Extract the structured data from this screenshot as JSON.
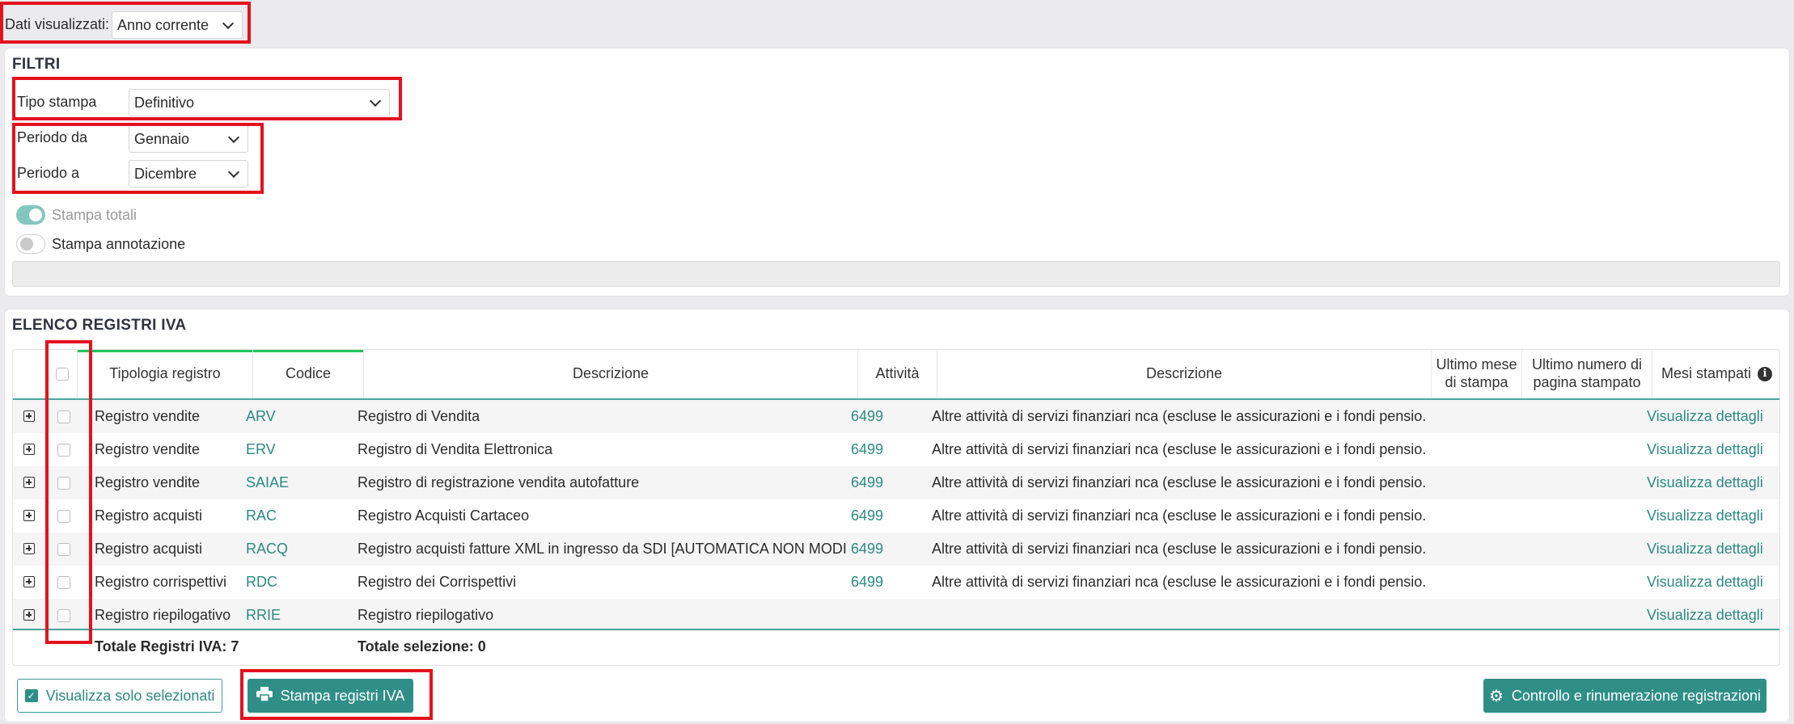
{
  "top": {
    "label": "Dati visualizzati:",
    "select_value": "Anno corrente"
  },
  "filters": {
    "title": "FILTRI",
    "tipo_stampa_label": "Tipo stampa",
    "tipo_stampa_value": "Definitivo",
    "periodo_da_label": "Periodo da",
    "periodo_da_value": "Gennaio",
    "periodo_a_label": "Periodo a",
    "periodo_a_value": "Dicembre",
    "stampa_totali_label": "Stampa totali",
    "stampa_annotazione_label": "Stampa annotazione"
  },
  "registri": {
    "title": "ELENCO REGISTRI IVA",
    "headers": {
      "tipologia": "Tipologia registro",
      "codice": "Codice",
      "descrizione": "Descrizione",
      "attivita": "Attività",
      "descrizione2": "Descrizione",
      "ultimo_mese_1": "Ultimo mese",
      "ultimo_mese_2": "di stampa",
      "ultimo_numero_1": "Ultimo numero di",
      "ultimo_numero_2": "pagina stampato",
      "mesi_stampati": "Mesi stampati"
    },
    "rows": [
      {
        "tipologia": "Registro vendite",
        "codice": "ARV",
        "descrizione": "Registro di Vendita",
        "attivita": "6499",
        "desc_attivita": "Altre attività di servizi finanziari nca (escluse le assicurazioni e i fondi pensio...",
        "link": "Visualizza dettagli"
      },
      {
        "tipologia": "Registro vendite",
        "codice": "ERV",
        "descrizione": "Registro di Vendita Elettronica",
        "attivita": "6499",
        "desc_attivita": "Altre attività di servizi finanziari nca (escluse le assicurazioni e i fondi pensio...",
        "link": "Visualizza dettagli"
      },
      {
        "tipologia": "Registro vendite",
        "codice": "SAIAE",
        "descrizione": "Registro di registrazione vendita autofatture",
        "attivita": "6499",
        "desc_attivita": "Altre attività di servizi finanziari nca (escluse le assicurazioni e i fondi pensio...",
        "link": "Visualizza dettagli"
      },
      {
        "tipologia": "Registro acquisti",
        "codice": "RAC",
        "descrizione": "Registro Acquisti Cartaceo",
        "attivita": "6499",
        "desc_attivita": "Altre attività di servizi finanziari nca (escluse le assicurazioni e i fondi pensio...",
        "link": "Visualizza dettagli"
      },
      {
        "tipologia": "Registro acquisti",
        "codice": "RACQ",
        "descrizione": "Registro acquisti fatture XML in ingresso da SDI [AUTOMATICA NON MODI...",
        "attivita": "6499",
        "desc_attivita": "Altre attività di servizi finanziari nca (escluse le assicurazioni e i fondi pensio...",
        "link": "Visualizza dettagli"
      },
      {
        "tipologia": "Registro corrispettivi",
        "codice": "RDC",
        "descrizione": "Registro dei Corrispettivi",
        "attivita": "6499",
        "desc_attivita": "Altre attività di servizi finanziari nca (escluse le assicurazioni e i fondi pensio...",
        "link": "Visualizza dettagli"
      },
      {
        "tipologia": "Registro riepilogativo",
        "codice": "RRIE",
        "descrizione": "Registro riepilogativo",
        "attivita": "",
        "desc_attivita": "",
        "link": "Visualizza dettagli"
      }
    ],
    "totale_registri": "Totale Registri IVA: 7",
    "totale_selezione": "Totale selezione: 0"
  },
  "buttons": {
    "visualizza_selezionati": "Visualizza solo selezionati",
    "stampa_registri": "Stampa registri IVA",
    "controllo": "Controllo e rinumerazione registrazioni"
  }
}
